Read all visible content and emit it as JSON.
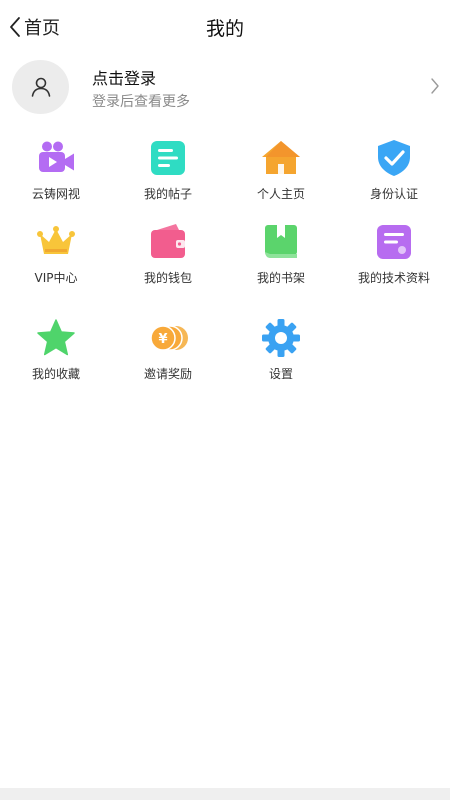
{
  "nav": {
    "back_label": "首页",
    "title": "我的"
  },
  "profile": {
    "login_title": "点击登录",
    "login_subtitle": "登录后查看更多"
  },
  "menu": [
    {
      "label": "云铸网视",
      "icon": "video-camera-icon",
      "color": "#b46cf3"
    },
    {
      "label": "我的帖子",
      "icon": "note-icon",
      "color": "#2fdcc3"
    },
    {
      "label": "个人主页",
      "icon": "home-icon",
      "color": "#f5a52f"
    },
    {
      "label": "身份认证",
      "icon": "shield-check-icon",
      "color": "#3aa6f5"
    },
    {
      "label": "VIP中心",
      "icon": "crown-icon",
      "color": "#f8c53a"
    },
    {
      "label": "我的钱包",
      "icon": "wallet-icon",
      "color": "#f25d8e"
    },
    {
      "label": "我的书架",
      "icon": "book-icon",
      "color": "#5bd46c"
    },
    {
      "label": "我的技术资料",
      "icon": "document-icon",
      "color": "#b76cf0"
    },
    {
      "label": "我的收藏",
      "icon": "star-icon",
      "color": "#4fd46b"
    },
    {
      "label": "邀请奖励",
      "icon": "coins-icon",
      "color": "#f8a93a"
    },
    {
      "label": "设置",
      "icon": "gear-icon",
      "color": "#3aa2f2"
    }
  ]
}
